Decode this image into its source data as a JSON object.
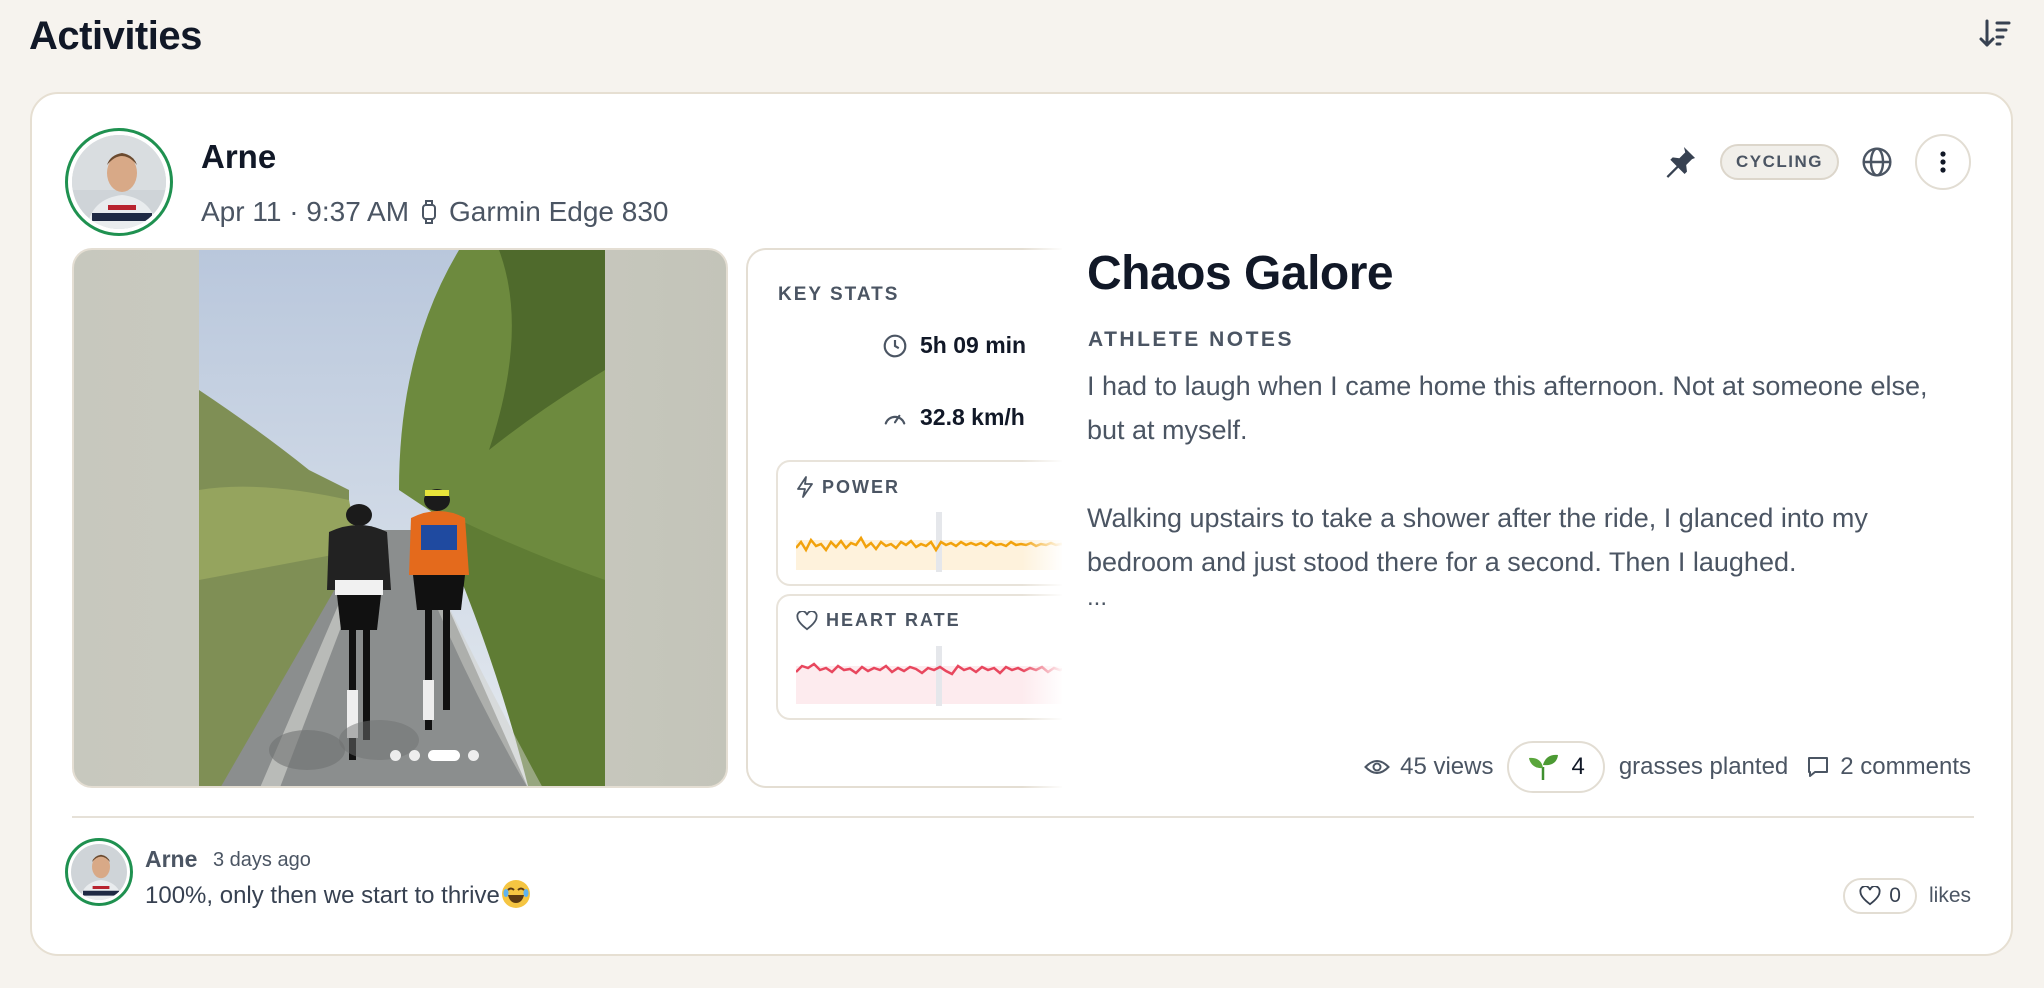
{
  "page": {
    "title": "Activities"
  },
  "activity": {
    "athlete_name": "Arne",
    "date_time": "Apr 11 · 9:37 AM",
    "device": "Garmin Edge 830",
    "sport_badge": "CYCLING",
    "title": "Chaos Galore",
    "notes_label": "ATHLETE NOTES",
    "notes": [
      "I had to laugh when I came home this afternoon. Not at someone else, but at myself.",
      "Walking upstairs to take a shower after the ride, I glanced into my bedroom and just stood there for a second. Then I laughed."
    ],
    "notes_ellipsis": "...",
    "photo": {
      "dots": 4,
      "active_dot": 3
    },
    "key_stats": {
      "label": "KEY STATS",
      "duration": "5h 09 min",
      "avg_speed": "32.8 km/h",
      "power_label": "POWER",
      "heart_rate_label": "HEART RATE"
    },
    "engagement": {
      "views": "45 views",
      "grasses_count": "4",
      "grasses_label": "grasses planted",
      "comments": "2 comments"
    }
  },
  "comment": {
    "author": "Arne",
    "time": "3 days ago",
    "text": "100%, only then we start to thrive",
    "likes_count": "0",
    "likes_label": "likes"
  },
  "colors": {
    "accent_green": "#1f9150",
    "power_line": "#f2a20c",
    "heart_line": "#e8475e"
  }
}
